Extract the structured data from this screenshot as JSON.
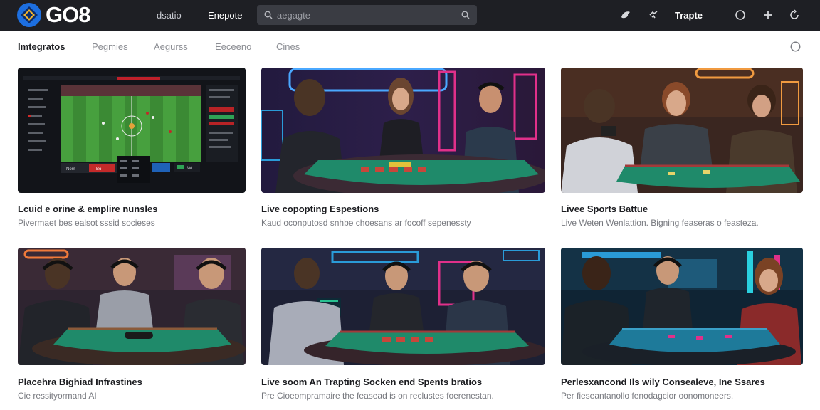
{
  "header": {
    "logo_text": "GO8",
    "nav": [
      "dsatio",
      "Enepote"
    ],
    "search_placeholder": "aegagte",
    "right_label": "Trapte"
  },
  "subnav": {
    "tabs": [
      "Imtegratos",
      "Pegmies",
      "Aegurss",
      "Eeceeno",
      "Cines"
    ]
  },
  "cards": [
    {
      "title": "Lcuid e orine & emplire nunsles",
      "desc": "Pivermaet bes ealsot sssid socieses"
    },
    {
      "title": "Live copopting Espestions",
      "desc": "Kaud oconputosd snhbe choesans ar focoff sepenessty"
    },
    {
      "title": "Livee Sports Battue",
      "desc": "Live Weten Wenlattion. Bigning feaseras o feasteza."
    },
    {
      "title": "Placehra Bighiad Infrastines",
      "desc": "Cie ressityormand AI"
    },
    {
      "title": "Live soom An Trapting Socken end Spents bratios",
      "desc": "Pre Cioeompramaire the feasead is on reclustes foerenestan."
    },
    {
      "title": "Perlesxancond Ils wily Consealeve, Ine Ssares",
      "desc": "Per fieseantanollo fenodagcior oonomoneers."
    }
  ],
  "scoreboard": [
    "Nom",
    "Bo",
    "Wt"
  ],
  "colors": {
    "topbar": "#1e1f24",
    "accent": "#1d6fe0",
    "felt": "#1f8a6a",
    "neon_pink": "#e0308a",
    "neon_blue": "#2a9bd8"
  }
}
